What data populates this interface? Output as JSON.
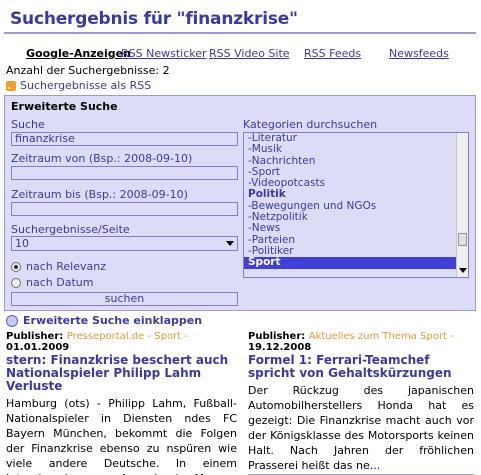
{
  "header": {
    "title": "Suchergebnis für \"finanzkrise\""
  },
  "tabs": [
    {
      "label": "Google-Anzeigen"
    },
    {
      "label": "RSS Newsticker"
    },
    {
      "label": "RSS Video Site"
    },
    {
      "label": "RSS Feeds"
    },
    {
      "label": "Newsfeeds"
    }
  ],
  "results_count": "Anzahl der Suchergebnisse: 2",
  "rss_link": "Suchergebnisse als RSS",
  "search": {
    "title": "Erweiterte Suche",
    "query_label": "Suche",
    "query_value": "finanzkrise",
    "from_label": "Zeitraum von (Bsp.: 2008-09-10)",
    "from_value": "",
    "to_label": "Zeitraum bis (Bsp.: 2008-09-10)",
    "to_value": "",
    "per_page_label": "Suchergebnisse/Seite",
    "per_page_value": "10",
    "sort_relevance": "nach Relevanz",
    "sort_date": "nach Datum",
    "submit_label": "suchen",
    "categories_label": "Kategorien durchsuchen",
    "categories": [
      "-Literatur",
      "-Musik",
      "-Nachrichten",
      "-Sport",
      "-Videopotcasts",
      "Politik",
      "-Bewegungen und NGOs",
      "-Netzpolitik",
      "-News",
      "-Parteien",
      "-Politiker",
      "Sport"
    ]
  },
  "collapse_link": "Erweiterte Suche einklappen",
  "results": [
    {
      "publisher_label": "Publisher:",
      "source": "Presseportal.de - Sport -",
      "date": "01.01.2009",
      "title": "stern: Finanzkrise beschert auch Nationalspieler Philipp Lahm Verluste",
      "snippet": "Hamburg (ots) - Philipp Lahm, Fußball-Nationalspieler in Diensten ndes FC Bayern München, bekommt die Folgen der Finanzkrise ebenso zu nspüren wie viele andere Deutsche. In einem Interview der neuen Ausgabe des Maga"
    },
    {
      "publisher_label": "Publisher:",
      "source": "Aktuelles zum Thema Sport -",
      "date": "19.12.2008",
      "title": "Formel 1: Ferrari-Teamchef spricht von Gehaltskürzungen",
      "snippet": "Der Rückzug des japanischen Automobilherstellers Honda hat es gezeigt: Die Finanzkrise macht auch vor der Königsklasse des Motorsports keinen Halt. Nach Jahren der fröhlichen Prasserei heißt das ne..."
    }
  ]
}
